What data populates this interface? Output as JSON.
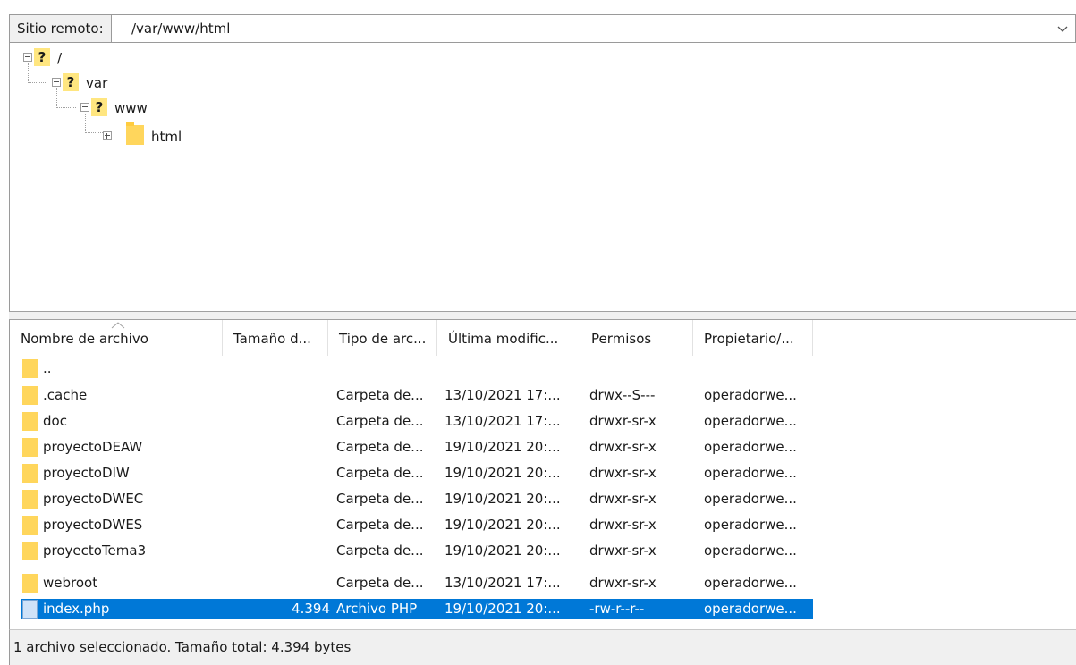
{
  "path_bar": {
    "label": "Sitio remoto:",
    "value": "/var/www/html"
  },
  "tree": [
    {
      "label": "/",
      "icon": "question-icon"
    },
    {
      "label": "var",
      "icon": "question-icon"
    },
    {
      "label": "www",
      "icon": "question-icon"
    },
    {
      "label": "html",
      "icon": "folder-icon"
    }
  ],
  "file_list": {
    "columns": [
      "Nombre de archivo",
      "Tamaño d...",
      "Tipo de arc...",
      "Última modific...",
      "Permisos",
      "Propietario/..."
    ],
    "rows": [
      {
        "name": "..",
        "size": "",
        "type": "",
        "modified": "",
        "permissions": "",
        "owner": "",
        "icon": "folder-icon",
        "selected": false
      },
      {
        "name": ".cache",
        "size": "",
        "type": "Carpeta de...",
        "modified": "13/10/2021 17:...",
        "permissions": "drwx--S---",
        "owner": "operadorwe...",
        "icon": "folder-icon",
        "selected": false
      },
      {
        "name": "doc",
        "size": "",
        "type": "Carpeta de...",
        "modified": "13/10/2021 17:...",
        "permissions": "drwxr-sr-x",
        "owner": "operadorwe...",
        "icon": "folder-icon",
        "selected": false
      },
      {
        "name": "proyectoDEAW",
        "size": "",
        "type": "Carpeta de...",
        "modified": "19/10/2021 20:...",
        "permissions": "drwxr-sr-x",
        "owner": "operadorwe...",
        "icon": "folder-icon",
        "selected": false
      },
      {
        "name": "proyectoDIW",
        "size": "",
        "type": "Carpeta de...",
        "modified": "19/10/2021 20:...",
        "permissions": "drwxr-sr-x",
        "owner": "operadorwe...",
        "icon": "folder-icon",
        "selected": false
      },
      {
        "name": "proyectoDWEC",
        "size": "",
        "type": "Carpeta de...",
        "modified": "19/10/2021 20:...",
        "permissions": "drwxr-sr-x",
        "owner": "operadorwe...",
        "icon": "folder-icon",
        "selected": false
      },
      {
        "name": "proyectoDWES",
        "size": "",
        "type": "Carpeta de...",
        "modified": "19/10/2021 20:...",
        "permissions": "drwxr-sr-x",
        "owner": "operadorwe...",
        "icon": "folder-icon",
        "selected": false
      },
      {
        "name": "proyectoTema3",
        "size": "",
        "type": "Carpeta de...",
        "modified": "19/10/2021 20:...",
        "permissions": "drwxr-sr-x",
        "owner": "operadorwe...",
        "icon": "folder-icon",
        "selected": false
      },
      {
        "name": "webroot",
        "size": "",
        "type": "Carpeta de...",
        "modified": "13/10/2021 17:...",
        "permissions": "drwxr-sr-x",
        "owner": "operadorwe...",
        "icon": "folder-icon",
        "selected": false
      },
      {
        "name": "index.php",
        "size": "4.394",
        "type": "Archivo PHP",
        "modified": "19/10/2021 20:...",
        "permissions": "-rw-r--r--",
        "owner": "operadorwe...",
        "icon": "php-file-icon",
        "selected": true
      }
    ]
  },
  "status": "1 archivo seleccionado. Tamaño total: 4.394 bytes",
  "colors": {
    "selection": "#0078d7",
    "folder": "#ffd65c",
    "unknown_dir": "#ffe680"
  }
}
